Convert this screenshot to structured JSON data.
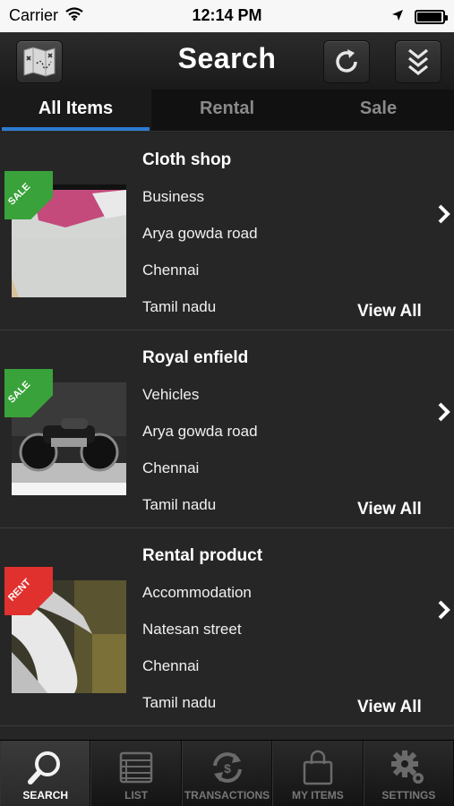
{
  "status": {
    "carrier": "Carrier",
    "time": "12:14 PM",
    "battery_level": 0.95
  },
  "nav": {
    "title": "Search",
    "map_icon": "map-icon",
    "refresh_icon": "refresh-icon",
    "menu_icon": "double-chevron-down-icon"
  },
  "tabs": [
    {
      "label": "All Items",
      "active": true
    },
    {
      "label": "Rental",
      "active": false
    },
    {
      "label": "Sale",
      "active": false
    }
  ],
  "items": [
    {
      "badge": "SALE",
      "badge_color": "#3aa23a",
      "title": "Cloth shop",
      "category": "Business",
      "street": "Arya gowda road",
      "city": "Chennai",
      "state": "Tamil nadu",
      "action": "View All"
    },
    {
      "badge": "SALE",
      "badge_color": "#3aa23a",
      "title": "Royal enfield",
      "category": "Vehicles",
      "street": "Arya gowda road",
      "city": "Chennai",
      "state": "Tamil nadu",
      "action": "View All"
    },
    {
      "badge": "RENT",
      "badge_color": "#e0312f",
      "title": "Rental product",
      "category": "Accommodation",
      "street": "Natesan street",
      "city": "Chennai",
      "state": "Tamil nadu",
      "action": "View All"
    }
  ],
  "tab_bar": [
    {
      "label": "SEARCH",
      "icon": "search-icon",
      "active": true
    },
    {
      "label": "LIST",
      "icon": "list-icon",
      "active": false
    },
    {
      "label": "TRANSACTIONS",
      "icon": "transactions-icon",
      "active": false
    },
    {
      "label": "MY ITEMS",
      "icon": "shopping-bag-icon",
      "active": false
    },
    {
      "label": "SETTINGS",
      "icon": "gear-icon",
      "active": false
    }
  ],
  "colors": {
    "accent": "#2e7bd1",
    "sale": "#3aa23a",
    "rent": "#e0312f",
    "background": "#262626"
  }
}
